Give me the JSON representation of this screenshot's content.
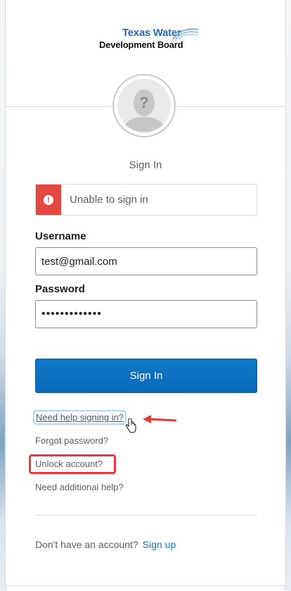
{
  "brand": {
    "logo_line1": "Texas Water",
    "logo_line2": "Development Board"
  },
  "avatar": {
    "icon": "user-placeholder-icon",
    "glyph": "?"
  },
  "form": {
    "title": "Sign In",
    "error": {
      "icon": "error-icon",
      "glyph": "!",
      "message": "Unable to sign in",
      "color": "#e34843"
    },
    "username": {
      "label": "Username",
      "value": "test@gmail.com"
    },
    "password": {
      "label": "Password",
      "value": "•••••••••••••"
    },
    "submit_label": "Sign In",
    "accent_color": "#0e77c8"
  },
  "links": {
    "need_help": "Need help signing in?",
    "forgot_password": "Forgot password?",
    "unlock_account": "Unlock account?",
    "additional_help": "Need additional help?"
  },
  "signup": {
    "prompt": "Don't have an account?",
    "link": "Sign up"
  },
  "annotations": {
    "arrow_color": "#e33b3b",
    "highlight_color": "#e33b3b"
  }
}
